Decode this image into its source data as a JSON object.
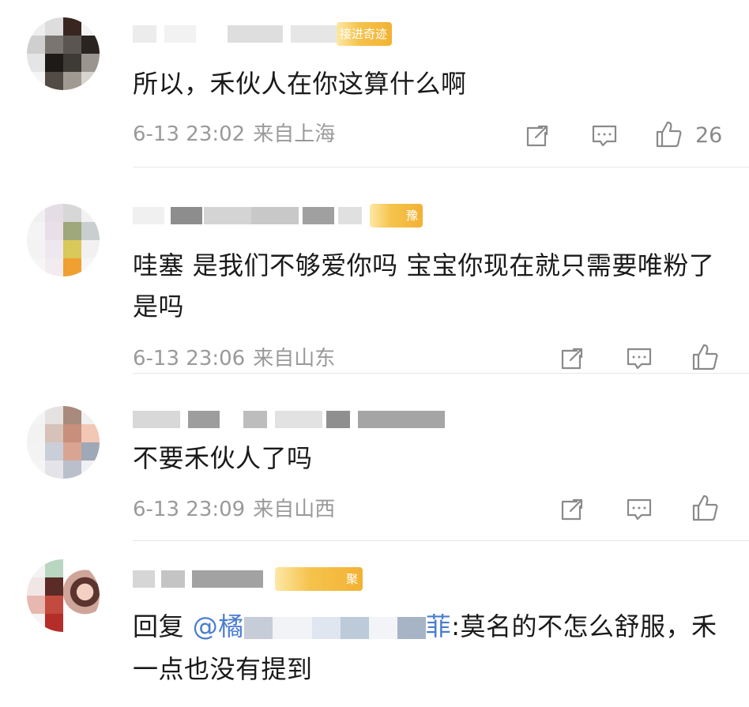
{
  "colors": {
    "meta": "#9a9a9a",
    "mention": "#4a7dd0",
    "badge": "#f2b234",
    "divider": "#e8e8e8"
  },
  "icons": {
    "share": "share-icon",
    "reply": "comment-icon",
    "like": "thumbs-up-icon"
  },
  "comments": [
    {
      "badge": "接进奇迹",
      "text": "所以，禾伙人在你这算什么啊",
      "date": "6-13 23:02",
      "location": "来自上海",
      "likes": "26"
    },
    {
      "badge": "豫",
      "text": "哇塞 是我们不够爱你吗 宝宝你现在就只需要唯粉了是吗",
      "date": "6-13 23:06",
      "location": "来自山东",
      "likes": ""
    },
    {
      "badge": "",
      "text": "不要禾伙人了吗",
      "date": "6-13 23:09",
      "location": "来自山西",
      "likes": ""
    },
    {
      "badge": "聚",
      "reply_prefix": "回复",
      "mention": "@橘",
      "mention_tail": "菲",
      "text": ":莫名的不怎么舒服，禾一点也没有提到"
    }
  ]
}
